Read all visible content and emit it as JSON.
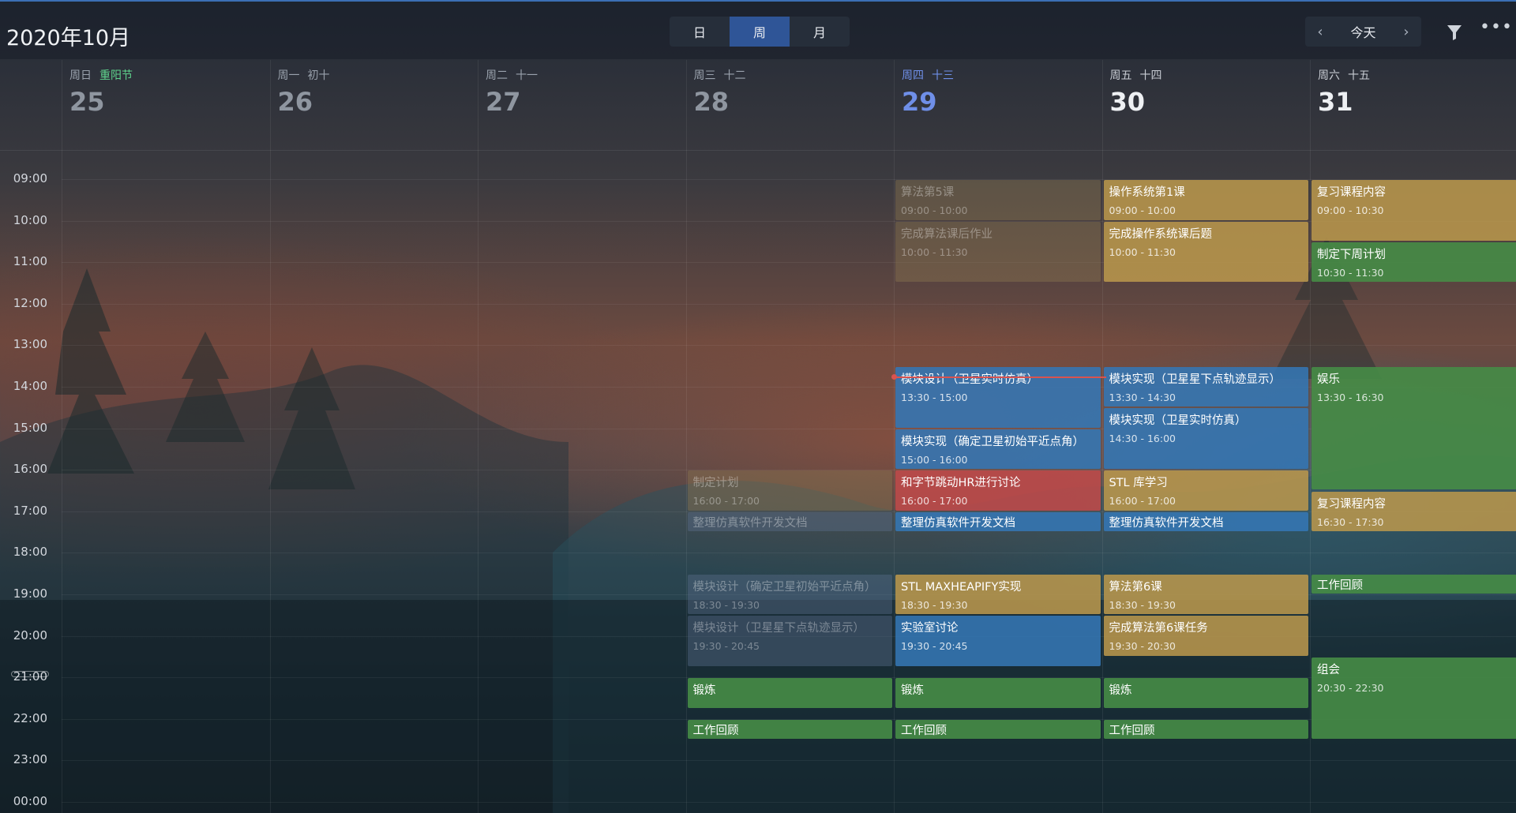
{
  "header": {
    "title": "2020年10月",
    "views": [
      {
        "label": "日",
        "active": false
      },
      {
        "label": "周",
        "active": true
      },
      {
        "label": "月",
        "active": false
      }
    ],
    "today_label": "今天",
    "prev_icon": "chevron-left-icon",
    "next_icon": "chevron-right-icon",
    "filter_icon": "filter-icon",
    "more_icon": "more-icon"
  },
  "days": [
    {
      "dow": "周日",
      "lunar": "重阳节",
      "holiday": true,
      "num": "25"
    },
    {
      "dow": "周一",
      "lunar": "初十",
      "holiday": false,
      "num": "26"
    },
    {
      "dow": "周二",
      "lunar": "十一",
      "holiday": false,
      "num": "27"
    },
    {
      "dow": "周三",
      "lunar": "十二",
      "holiday": false,
      "num": "28"
    },
    {
      "dow": "周四",
      "lunar": "十三",
      "holiday": false,
      "num": "29",
      "today": true
    },
    {
      "dow": "周五",
      "lunar": "十四",
      "holiday": false,
      "num": "30"
    },
    {
      "dow": "周六",
      "lunar": "十五",
      "holiday": false,
      "num": "31"
    }
  ],
  "hours": [
    "09:00",
    "10:00",
    "11:00",
    "12:00",
    "13:00",
    "14:00",
    "15:00",
    "16:00",
    "17:00",
    "18:00",
    "19:00",
    "20:00",
    "21:00",
    "22:00",
    "23:00",
    "00:00"
  ],
  "events": [
    {
      "day": 3,
      "title": "制定计划",
      "time": "16:00 - 17:00",
      "start": 16.0,
      "end": 17.0,
      "color": "yellow",
      "past": true
    },
    {
      "day": 3,
      "title": "整理仿真软件开发文档",
      "time": "",
      "start": 17.0,
      "end": 17.5,
      "color": "blue",
      "past": true
    },
    {
      "day": 3,
      "title": "模块设计（确定卫星初始平近点角）",
      "time": "18:30 - 19:30",
      "start": 18.5,
      "end": 19.5,
      "color": "blue",
      "past": true
    },
    {
      "day": 3,
      "title": "模块设计（卫星星下点轨迹显示）",
      "time": "19:30 - 20:45",
      "start": 19.5,
      "end": 20.75,
      "color": "blue",
      "past": true
    },
    {
      "day": 3,
      "title": "锻炼",
      "time": "",
      "start": 21.0,
      "end": 21.75,
      "color": "green",
      "past": false
    },
    {
      "day": 3,
      "title": "工作回顾",
      "time": "",
      "start": 22.0,
      "end": 22.5,
      "color": "green",
      "past": false
    },
    {
      "day": 4,
      "title": "算法第5课",
      "time": "09:00 - 10:00",
      "start": 9.0,
      "end": 10.0,
      "color": "yellow",
      "past": true
    },
    {
      "day": 4,
      "title": "完成算法课后作业",
      "time": "10:00 - 11:30",
      "start": 10.0,
      "end": 11.5,
      "color": "yellow",
      "past": true
    },
    {
      "day": 4,
      "title": "模块设计（卫星实时仿真）",
      "time": "13:30 - 15:00",
      "start": 13.5,
      "end": 15.0,
      "color": "blue",
      "past": false
    },
    {
      "day": 4,
      "title": "模块实现（确定卫星初始平近点角）",
      "time": "15:00 - 16:00",
      "start": 15.0,
      "end": 16.0,
      "color": "blue",
      "past": false
    },
    {
      "day": 4,
      "title": "和字节跳动HR进行讨论",
      "time": "16:00 - 17:00",
      "start": 16.0,
      "end": 17.0,
      "color": "red",
      "past": false
    },
    {
      "day": 4,
      "title": "整理仿真软件开发文档",
      "time": "",
      "start": 17.0,
      "end": 17.5,
      "color": "blue",
      "past": false
    },
    {
      "day": 4,
      "title": "STL MAXHEAPIFY实现",
      "time": "18:30 - 19:30",
      "start": 18.5,
      "end": 19.5,
      "color": "yellow",
      "past": false
    },
    {
      "day": 4,
      "title": "实验室讨论",
      "time": "19:30 - 20:45",
      "start": 19.5,
      "end": 20.75,
      "color": "blue",
      "past": false
    },
    {
      "day": 4,
      "title": "锻炼",
      "time": "",
      "start": 21.0,
      "end": 21.75,
      "color": "green",
      "past": false
    },
    {
      "day": 4,
      "title": "工作回顾",
      "time": "",
      "start": 22.0,
      "end": 22.5,
      "color": "green",
      "past": false
    },
    {
      "day": 5,
      "title": "操作系统第1课",
      "time": "09:00 - 10:00",
      "start": 9.0,
      "end": 10.0,
      "color": "yellow",
      "past": false
    },
    {
      "day": 5,
      "title": "完成操作系统课后题",
      "time": "10:00 - 11:30",
      "start": 10.0,
      "end": 11.5,
      "color": "yellow",
      "past": false
    },
    {
      "day": 5,
      "title": "模块实现（卫星星下点轨迹显示）",
      "time": "13:30 - 14:30",
      "start": 13.5,
      "end": 14.5,
      "color": "blue",
      "past": false
    },
    {
      "day": 5,
      "title": "模块实现（卫星实时仿真）",
      "time": "14:30 - 16:00",
      "start": 14.5,
      "end": 16.0,
      "color": "blue",
      "past": false
    },
    {
      "day": 5,
      "title": "STL 库学习",
      "time": "16:00 - 17:00",
      "start": 16.0,
      "end": 17.0,
      "color": "yellow",
      "past": false
    },
    {
      "day": 5,
      "title": "整理仿真软件开发文档",
      "time": "",
      "start": 17.0,
      "end": 17.5,
      "color": "blue",
      "past": false
    },
    {
      "day": 5,
      "title": "算法第6课",
      "time": "18:30 - 19:30",
      "start": 18.5,
      "end": 19.5,
      "color": "yellow",
      "past": false
    },
    {
      "day": 5,
      "title": "完成算法第6课任务",
      "time": "19:30 - 20:30",
      "start": 19.5,
      "end": 20.5,
      "color": "yellow",
      "past": false
    },
    {
      "day": 5,
      "title": "锻炼",
      "time": "",
      "start": 21.0,
      "end": 21.75,
      "color": "green",
      "past": false
    },
    {
      "day": 5,
      "title": "工作回顾",
      "time": "",
      "start": 22.0,
      "end": 22.5,
      "color": "green",
      "past": false
    },
    {
      "day": 6,
      "title": "复习课程内容",
      "time": "09:00 - 10:30",
      "start": 9.0,
      "end": 10.5,
      "color": "yellow",
      "past": false
    },
    {
      "day": 6,
      "title": "制定下周计划",
      "time": "10:30 - 11:30",
      "start": 10.5,
      "end": 11.5,
      "color": "green",
      "past": false
    },
    {
      "day": 6,
      "title": "娱乐",
      "time": "13:30 - 16:30",
      "start": 13.5,
      "end": 16.5,
      "color": "green",
      "past": false
    },
    {
      "day": 6,
      "title": "复习课程内容",
      "time": "16:30 - 17:30",
      "start": 16.5,
      "end": 17.5,
      "color": "yellow",
      "past": false
    },
    {
      "day": 6,
      "title": "工作回顾",
      "time": "",
      "start": 18.5,
      "end": 19.0,
      "color": "green",
      "past": false
    },
    {
      "day": 6,
      "title": "组会",
      "time": "20:30 - 22:30",
      "start": 20.5,
      "end": 22.5,
      "color": "green",
      "past": false
    }
  ],
  "now_time": 13.75
}
